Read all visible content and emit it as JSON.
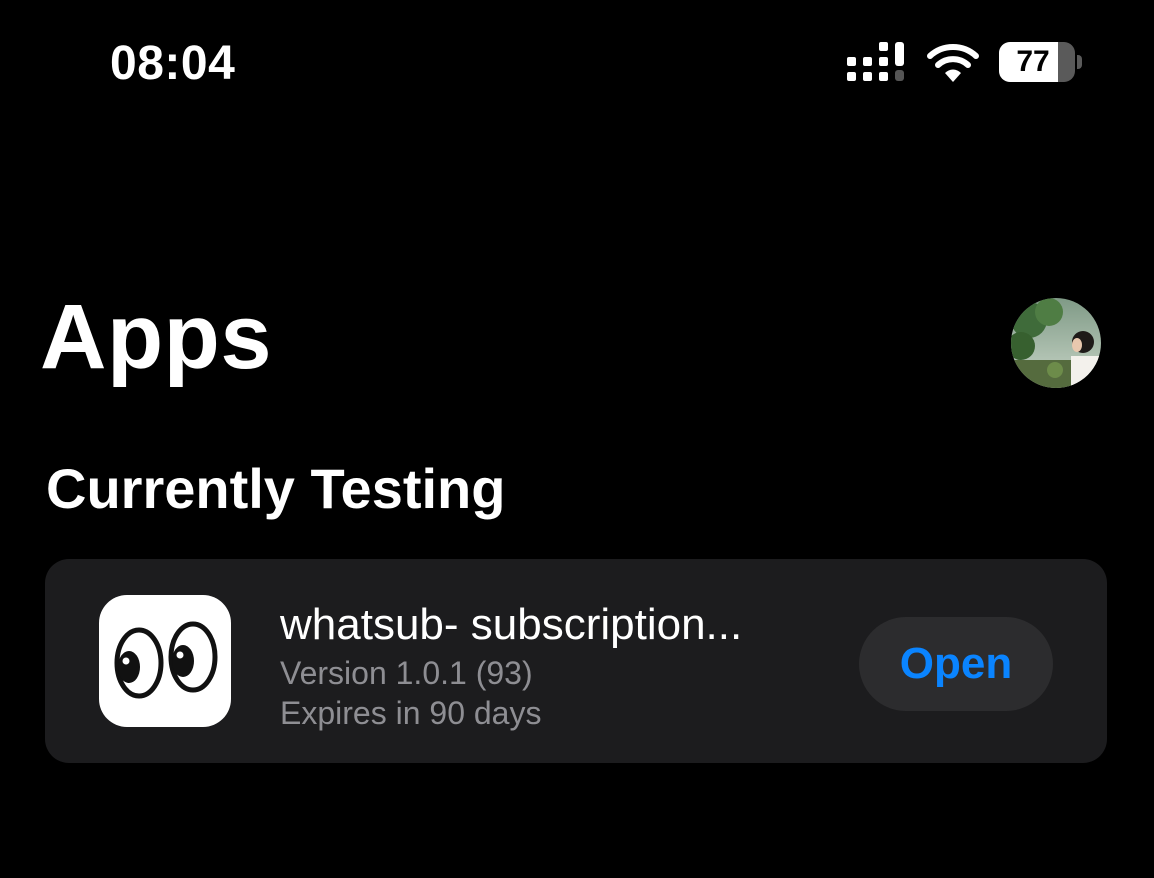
{
  "status_bar": {
    "time": "08:04",
    "battery_level": "77",
    "icons": [
      "signal-icon",
      "wifi-icon",
      "battery-icon"
    ]
  },
  "header": {
    "title": "Apps",
    "avatar_icon": "profile-photo"
  },
  "section": {
    "title": "Currently Testing"
  },
  "app": {
    "name": "whatsub- subscription...",
    "version": "Version 1.0.1 (93)",
    "expiry": "Expires in 90 days",
    "open_label": "Open",
    "icon": "eyes-icon"
  },
  "colors": {
    "background": "#000000",
    "card": "#1c1c1e",
    "button_bg": "#2c2c2e",
    "accent": "#0a84ff",
    "secondary_text": "#8e8e93"
  }
}
